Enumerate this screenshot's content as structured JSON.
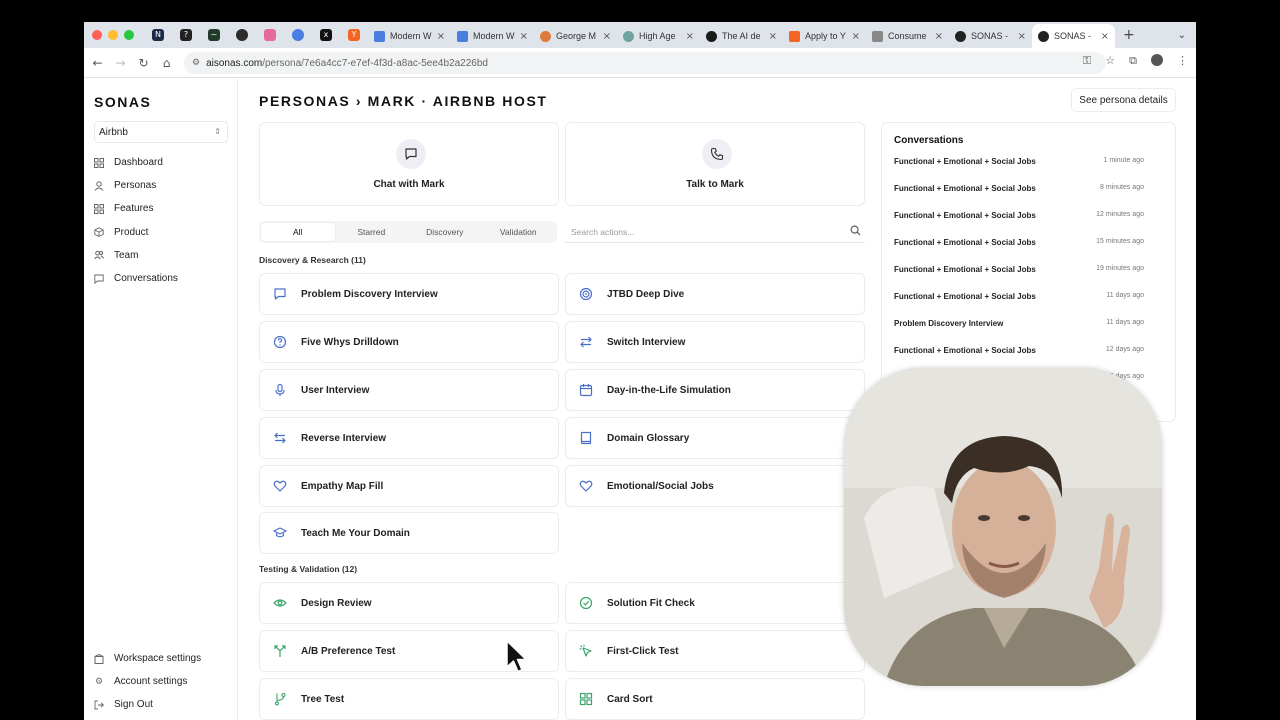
{
  "browser": {
    "tabs": [
      {
        "label": "Modern W"
      },
      {
        "label": "Modern W"
      },
      {
        "label": "George M"
      },
      {
        "label": "High Age"
      },
      {
        "label": "The AI de"
      },
      {
        "label": "Apply to Y"
      },
      {
        "label": "Consume"
      },
      {
        "label": "SONAS -"
      },
      {
        "label": "SONAS -"
      }
    ],
    "url_host": "aisonas.com",
    "url_path": "/persona/7e6a4cc7-e7ef-4f3d-a8ac-5ee4b2a226bd"
  },
  "sidebar": {
    "brand": "SONAS",
    "workspace": "Airbnb",
    "items": [
      {
        "label": "Dashboard",
        "icon": "grid-icon"
      },
      {
        "label": "Personas",
        "icon": "person-icon"
      },
      {
        "label": "Features",
        "icon": "grid-icon"
      },
      {
        "label": "Product",
        "icon": "box-icon"
      },
      {
        "label": "Team",
        "icon": "users-icon"
      },
      {
        "label": "Conversations",
        "icon": "chat-icon"
      }
    ],
    "bottom": [
      {
        "label": "Workspace settings"
      },
      {
        "label": "Account settings"
      },
      {
        "label": "Sign Out"
      }
    ]
  },
  "header": {
    "breadcrumb": "PERSONAS › MARK · AIRBNB HOST",
    "see_details": "See persona details"
  },
  "actions_top": {
    "chat": "Chat with Mark",
    "talk": "Talk to Mark"
  },
  "filters": {
    "tabs": [
      "All",
      "Starred",
      "Discovery",
      "Validation"
    ],
    "search_placeholder": "Search actions..."
  },
  "sections": [
    {
      "title": "Discovery & Research (11)",
      "items": [
        "Problem Discovery Interview",
        "JTBD Deep Dive",
        "Five Whys Drilldown",
        "Switch Interview",
        "User Interview",
        "Day-in-the-Life Simulation",
        "Reverse Interview",
        "Domain Glossary",
        "Empathy Map Fill",
        "Emotional/Social Jobs",
        "Teach Me Your Domain"
      ]
    },
    {
      "title": "Testing & Validation (12)",
      "items": [
        "Design Review",
        "Solution Fit Check",
        "A/B Preference Test",
        "First-Click Test",
        "Tree Test",
        "Card Sort"
      ]
    }
  ],
  "conversations": {
    "title": "Conversations",
    "rows": [
      {
        "name": "Functional + Emotional + Social Jobs",
        "when": "1 minute ago"
      },
      {
        "name": "Functional + Emotional + Social Jobs",
        "when": "8 minutes ago"
      },
      {
        "name": "Functional + Emotional + Social Jobs",
        "when": "12 minutes ago"
      },
      {
        "name": "Functional + Emotional + Social Jobs",
        "when": "15 minutes ago"
      },
      {
        "name": "Functional + Emotional + Social Jobs",
        "when": "19 minutes ago"
      },
      {
        "name": "Functional + Emotional + Social Jobs",
        "when": "11 days ago"
      },
      {
        "name": "Problem Discovery Interview",
        "when": "11 days ago"
      },
      {
        "name": "Functional + Emotional + Social Jobs",
        "when": "12 days ago"
      },
      {
        "name": "",
        "when": "12 days ago"
      }
    ]
  },
  "colors": {
    "accent_icon_blue": "#4a6fc9",
    "accent_icon_green": "#3aa36a",
    "traffic_red": "#ff5f57",
    "traffic_yellow": "#febc2e",
    "traffic_green": "#28c840"
  }
}
